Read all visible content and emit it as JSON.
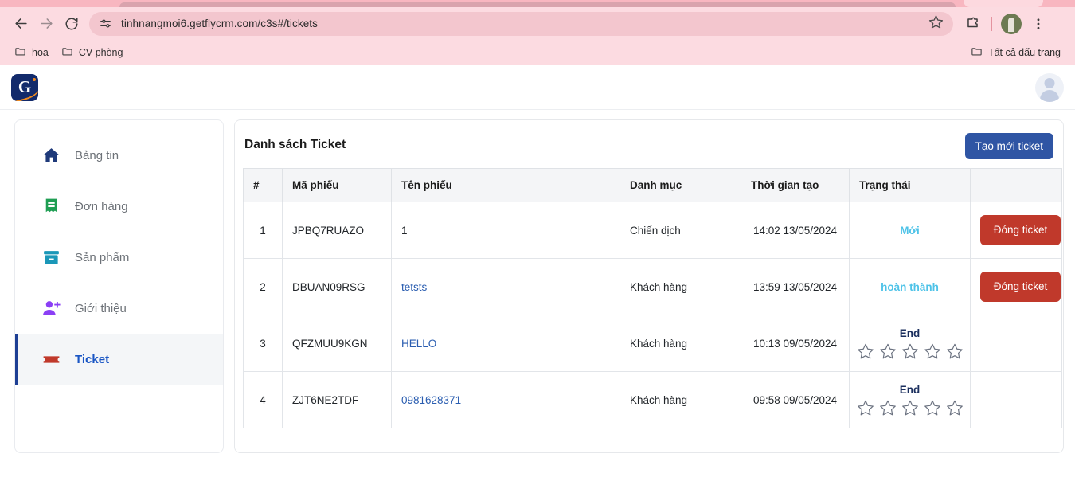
{
  "browser": {
    "back_icon": "back-arrow-icon",
    "forward_icon": "forward-arrow-icon",
    "reload_icon": "reload-icon",
    "site_info_icon": "site-settings-icon",
    "url": "tinhnangmoi6.getflycrm.com/c3s#/tickets",
    "bookmark_star_icon": "star-icon",
    "extensions_icon": "extensions-puzzle-icon",
    "profile_icon": "profile-avatar-icon",
    "menu_icon": "three-dot-menu-icon",
    "bookmarks": [
      {
        "label": "hoa"
      },
      {
        "label": "CV phòng"
      }
    ],
    "all_bookmarks_label": "Tất cả dấu trang"
  },
  "app": {
    "logo_letter": "G",
    "sidebar": {
      "items": [
        {
          "label": "Bảng tin",
          "icon": "home-icon",
          "active": false
        },
        {
          "label": "Đơn hàng",
          "icon": "receipt-icon",
          "active": false
        },
        {
          "label": "Sản phẩm",
          "icon": "box-icon",
          "active": false
        },
        {
          "label": "Giới thiệu",
          "icon": "add-person-icon",
          "active": false
        },
        {
          "label": "Ticket",
          "icon": "ticket-icon",
          "active": true
        }
      ]
    },
    "main": {
      "title": "Danh sách Ticket",
      "create_button": "Tạo mới ticket",
      "columns": [
        "#",
        "Mã phiếu",
        "Tên phiếu",
        "Danh mục",
        "Thời gian tạo",
        "Trạng thái",
        ""
      ],
      "rows": [
        {
          "index": "1",
          "code": "JPBQ7RUAZO",
          "name": "1",
          "name_is_link": false,
          "category": "Chiến dịch",
          "created": "14:02 13/05/2024",
          "status_type": "text",
          "status": "Mới",
          "action": "Đóng ticket"
        },
        {
          "index": "2",
          "code": "DBUAN09RSG",
          "name": "tetsts",
          "name_is_link": true,
          "category": "Khách hàng",
          "created": "13:59 13/05/2024",
          "status_type": "text",
          "status": "hoàn thành",
          "action": "Đóng ticket"
        },
        {
          "index": "3",
          "code": "QFZMUU9KGN",
          "name": "HELLO",
          "name_is_link": true,
          "category": "Khách hàng",
          "created": "10:13 09/05/2024",
          "status_type": "rating",
          "status": "End",
          "stars_total": 5,
          "stars_filled": 0,
          "action": ""
        },
        {
          "index": "4",
          "code": "ZJT6NE2TDF",
          "name": "0981628371",
          "name_is_link": true,
          "category": "Khách hàng",
          "created": "09:58 09/05/2024",
          "status_type": "rating",
          "status": "End",
          "stars_total": 5,
          "stars_filled": 0,
          "action": ""
        }
      ]
    }
  },
  "colors": {
    "chrome_pink": "#fcdbe1",
    "omnibox_pink": "#f3c6ce",
    "primary_blue": "#2f55a4",
    "danger_red": "#c0392b",
    "status_cyan": "#4ec3e8",
    "status_navy": "#1b2f5e",
    "link_blue": "#2a5db0",
    "active_nav_blue": "#1a56c4"
  }
}
